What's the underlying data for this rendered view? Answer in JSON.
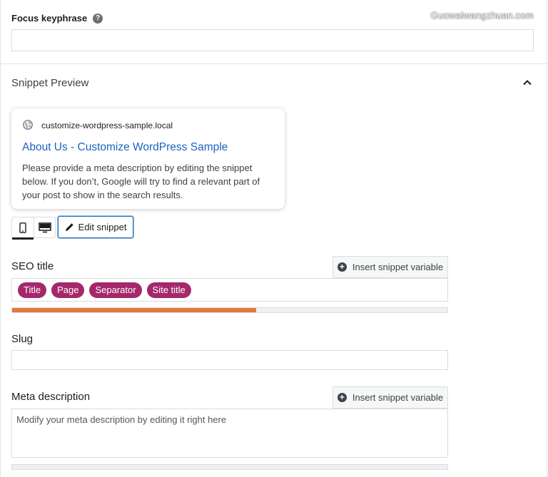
{
  "focus_keyphrase": {
    "label": "Focus keyphrase",
    "help_icon": "question-circle-icon",
    "value": ""
  },
  "watermark": "Guowaiwangzhuan.com",
  "snippet_preview": {
    "title": "Snippet Preview",
    "collapse_icon": "chevron-up-icon",
    "card": {
      "url": "customize-wordpress-sample.local",
      "title": "About Us - Customize WordPress Sample",
      "description": "Please provide a meta description by editing the snippet below. If you don’t, Google will try to find a relevant part of your post to show in the search results."
    },
    "mode": "mobile",
    "edit_label": "Edit snippet"
  },
  "seo_title": {
    "label": "SEO title",
    "insert_label": "Insert snippet variable",
    "pills": [
      "Title",
      "Page",
      "Separator",
      "Site title"
    ],
    "progress": 0.56,
    "progress_color": "#e07b3c"
  },
  "slug": {
    "label": "Slug",
    "value": ""
  },
  "meta_description": {
    "label": "Meta description",
    "insert_label": "Insert snippet variable",
    "placeholder": "Modify your meta description by editing it right here"
  },
  "colors": {
    "pill": "#a4286a",
    "link": "#1e63bf",
    "focus": "#2271b1"
  }
}
